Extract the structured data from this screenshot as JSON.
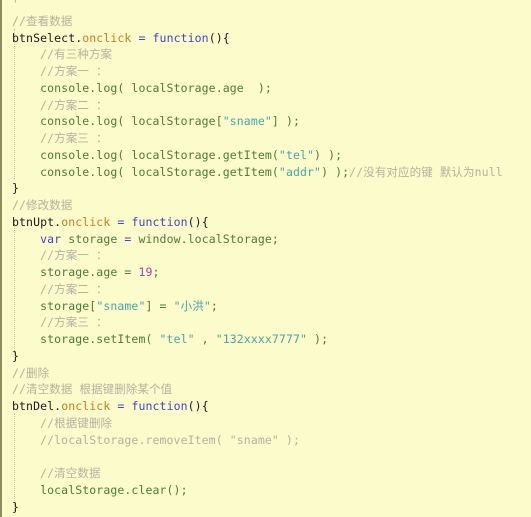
{
  "editor": {
    "background_color": "#fbfbcb",
    "left_border_color": "#8d8d5e",
    "indent_guide_color": "#c9c98a",
    "language": "JavaScript",
    "colors": {
      "comment": "#b3b3a0",
      "keyword": "#4444c4",
      "event_property": "#cc7a22",
      "identifier": "#4e7a3c",
      "string": "#4aa6a6",
      "number": "#b13fb1",
      "plain": "#1a1a1a"
    }
  },
  "lines": [
    {
      "n": 0,
      "text": "'"
    },
    {
      "n": 1,
      "text": "//查看数据"
    },
    {
      "n": 2,
      "text": "btnSelect.onclick = function(){"
    },
    {
      "n": 3,
      "text": "    //有三种方案"
    },
    {
      "n": 4,
      "text": "    //方案一 ："
    },
    {
      "n": 5,
      "text": "    console.log( localStorage.age  );"
    },
    {
      "n": 6,
      "text": "    //方案二 ："
    },
    {
      "n": 7,
      "text": "    console.log( localStorage[\"sname\"] );"
    },
    {
      "n": 8,
      "text": "    //方案三 ："
    },
    {
      "n": 9,
      "text": "    console.log( localStorage.getItem(\"tel\") );"
    },
    {
      "n": 10,
      "text": "    console.log( localStorage.getItem(\"addr\") );//没有对应的键 默认为null"
    },
    {
      "n": 11,
      "text": "}"
    },
    {
      "n": 12,
      "text": "//修改数据"
    },
    {
      "n": 13,
      "text": "btnUpt.onclick = function(){"
    },
    {
      "n": 14,
      "text": "    var storage = window.localStorage;"
    },
    {
      "n": 15,
      "text": "    //方案一 ："
    },
    {
      "n": 16,
      "text": "    storage.age = 19;"
    },
    {
      "n": 17,
      "text": "    //方案二 ："
    },
    {
      "n": 18,
      "text": "    storage[\"sname\"] = \"小洪\";"
    },
    {
      "n": 19,
      "text": "    //方案三 ："
    },
    {
      "n": 20,
      "text": "    storage.setItem( \"tel\" , \"132xxxx7777\" );"
    },
    {
      "n": 21,
      "text": "}"
    },
    {
      "n": 22,
      "text": "//删除"
    },
    {
      "n": 23,
      "text": "//清空数据 根据键删除某个值"
    },
    {
      "n": 24,
      "text": "btnDel.onclick = function(){"
    },
    {
      "n": 25,
      "text": "    //根据键删除"
    },
    {
      "n": 26,
      "text": "    //localStorage.removeItem( \"sname\" );"
    },
    {
      "n": 27,
      "text": ""
    },
    {
      "n": 28,
      "text": "    //清空数据"
    },
    {
      "n": 29,
      "text": "    localStorage.clear();"
    },
    {
      "n": 30,
      "text": "}"
    }
  ],
  "tokens": {
    "l0": [
      {
        "t": "'",
        "c": "cm"
      }
    ],
    "l1": [
      {
        "t": "//查看数据",
        "c": "cm"
      }
    ],
    "l2": [
      {
        "t": "btnSelect",
        "c": "pl"
      },
      {
        "t": ".",
        "c": "pl"
      },
      {
        "t": "onclick",
        "c": "ev"
      },
      {
        "t": " ",
        "c": "pl"
      },
      {
        "t": "=",
        "c": "kw"
      },
      {
        "t": " ",
        "c": "pl"
      },
      {
        "t": "function",
        "c": "kw"
      },
      {
        "t": "(){",
        "c": "punc"
      }
    ],
    "l3": [
      {
        "t": "    ",
        "c": "pl"
      },
      {
        "t": "//有三种方案",
        "c": "cm"
      }
    ],
    "l4": [
      {
        "t": "    ",
        "c": "pl"
      },
      {
        "t": "//方案一 ：",
        "c": "cm"
      }
    ],
    "l5": [
      {
        "t": "    ",
        "c": "pl"
      },
      {
        "t": "console.log( localStorage.age  );",
        "c": "id"
      }
    ],
    "l6": [
      {
        "t": "    ",
        "c": "pl"
      },
      {
        "t": "//方案二 ：",
        "c": "cm"
      }
    ],
    "l7": [
      {
        "t": "    ",
        "c": "pl"
      },
      {
        "t": "console.log( localStorage[",
        "c": "id"
      },
      {
        "t": "\"sname\"",
        "c": "str"
      },
      {
        "t": "] );",
        "c": "id"
      }
    ],
    "l8": [
      {
        "t": "    ",
        "c": "pl"
      },
      {
        "t": "//方案三 ：",
        "c": "cm"
      }
    ],
    "l9": [
      {
        "t": "    ",
        "c": "pl"
      },
      {
        "t": "console.log( localStorage.getItem(",
        "c": "id"
      },
      {
        "t": "\"tel\"",
        "c": "str"
      },
      {
        "t": ") );",
        "c": "id"
      }
    ],
    "l10": [
      {
        "t": "    ",
        "c": "pl"
      },
      {
        "t": "console.log( localStorage.getItem(",
        "c": "id"
      },
      {
        "t": "\"addr\"",
        "c": "str"
      },
      {
        "t": ") );",
        "c": "id"
      },
      {
        "t": "//没有对应的键 默认为null",
        "c": "cm"
      }
    ],
    "l11": [
      {
        "t": "}",
        "c": "punc"
      }
    ],
    "l12": [
      {
        "t": "//修改数据",
        "c": "cm"
      }
    ],
    "l13": [
      {
        "t": "btnUpt",
        "c": "pl"
      },
      {
        "t": ".",
        "c": "pl"
      },
      {
        "t": "onclick",
        "c": "ev"
      },
      {
        "t": " ",
        "c": "pl"
      },
      {
        "t": "=",
        "c": "kw"
      },
      {
        "t": " ",
        "c": "pl"
      },
      {
        "t": "function",
        "c": "kw"
      },
      {
        "t": "(){",
        "c": "punc"
      }
    ],
    "l14": [
      {
        "t": "    ",
        "c": "pl"
      },
      {
        "t": "var",
        "c": "kw"
      },
      {
        "t": " ",
        "c": "pl"
      },
      {
        "t": "storage ",
        "c": "id"
      },
      {
        "t": "=",
        "c": "kw"
      },
      {
        "t": " window.localStorage;",
        "c": "id"
      }
    ],
    "l15": [
      {
        "t": "    ",
        "c": "pl"
      },
      {
        "t": "//方案一 ：",
        "c": "cm"
      }
    ],
    "l16": [
      {
        "t": "    ",
        "c": "pl"
      },
      {
        "t": "storage.age = ",
        "c": "id"
      },
      {
        "t": "19",
        "c": "num"
      },
      {
        "t": ";",
        "c": "id"
      }
    ],
    "l17": [
      {
        "t": "    ",
        "c": "pl"
      },
      {
        "t": "//方案二 ：",
        "c": "cm"
      }
    ],
    "l18": [
      {
        "t": "    ",
        "c": "pl"
      },
      {
        "t": "storage[",
        "c": "id"
      },
      {
        "t": "\"sname\"",
        "c": "str"
      },
      {
        "t": "] = ",
        "c": "id"
      },
      {
        "t": "\"小洪\"",
        "c": "str"
      },
      {
        "t": ";",
        "c": "id"
      }
    ],
    "l19": [
      {
        "t": "    ",
        "c": "pl"
      },
      {
        "t": "//方案三 ：",
        "c": "cm"
      }
    ],
    "l20": [
      {
        "t": "    ",
        "c": "pl"
      },
      {
        "t": "storage.setItem( ",
        "c": "id"
      },
      {
        "t": "\"tel\"",
        "c": "str"
      },
      {
        "t": " , ",
        "c": "id"
      },
      {
        "t": "\"132xxxx7777\"",
        "c": "str"
      },
      {
        "t": " );",
        "c": "id"
      }
    ],
    "l21": [
      {
        "t": "}",
        "c": "punc"
      }
    ],
    "l22": [
      {
        "t": "//删除",
        "c": "cm"
      }
    ],
    "l23": [
      {
        "t": "//清空数据 根据键删除某个值",
        "c": "cm"
      }
    ],
    "l24": [
      {
        "t": "btnDel",
        "c": "pl"
      },
      {
        "t": ".",
        "c": "pl"
      },
      {
        "t": "onclick",
        "c": "ev"
      },
      {
        "t": " ",
        "c": "pl"
      },
      {
        "t": "=",
        "c": "kw"
      },
      {
        "t": " ",
        "c": "pl"
      },
      {
        "t": "function",
        "c": "kw"
      },
      {
        "t": "(){",
        "c": "punc"
      }
    ],
    "l25": [
      {
        "t": "    ",
        "c": "pl"
      },
      {
        "t": "//根据键删除",
        "c": "cm"
      }
    ],
    "l26": [
      {
        "t": "    ",
        "c": "pl"
      },
      {
        "t": "//localStorage.removeItem( \"sname\" );",
        "c": "cm"
      }
    ],
    "l27": [
      {
        "t": "",
        "c": "pl"
      }
    ],
    "l28": [
      {
        "t": "    ",
        "c": "pl"
      },
      {
        "t": "//清空数据",
        "c": "cm"
      }
    ],
    "l29": [
      {
        "t": "    ",
        "c": "pl"
      },
      {
        "t": "localStorage.clear();",
        "c": "id"
      }
    ],
    "l30": [
      {
        "t": "}",
        "c": "punc"
      }
    ]
  }
}
